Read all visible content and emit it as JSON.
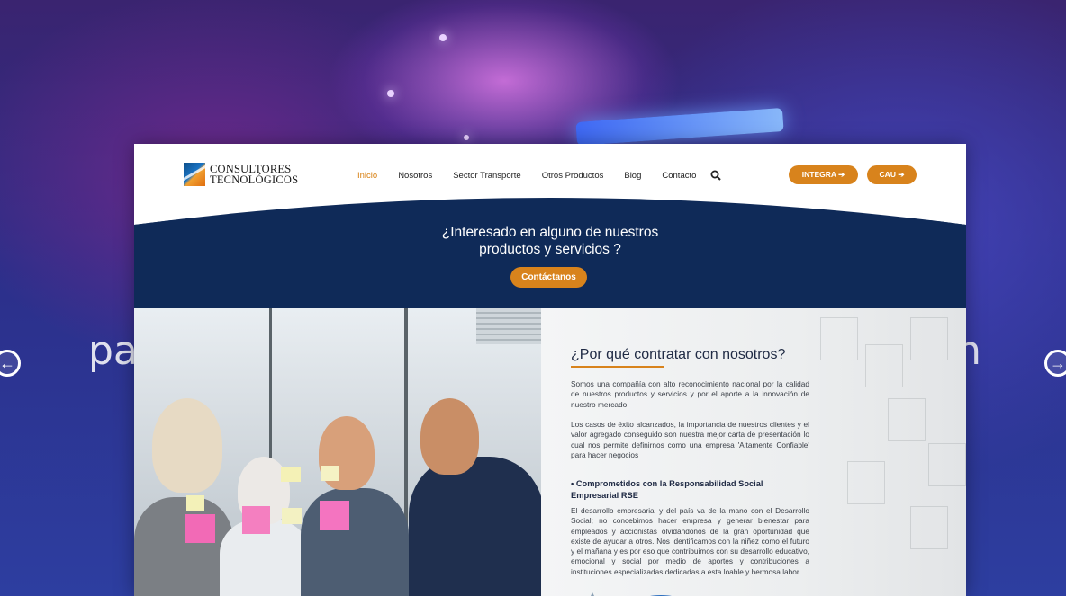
{
  "hero": {
    "bg_text_left": "pa",
    "bg_text_right": "n",
    "prev_arrow": "←",
    "next_arrow": "→"
  },
  "logo": {
    "line1": "CONSULTORES",
    "line2": "TECNOLÓGICOS"
  },
  "nav": {
    "items": [
      "Inicio",
      "Nosotros",
      "Sector Transporte",
      "Otros Productos",
      "Blog",
      "Contacto"
    ],
    "active_index": 0
  },
  "header_buttons": {
    "integra": "INTEGRA ➔",
    "cau": "CAU ➔"
  },
  "cta": {
    "title_line1": "¿Interesado en alguno de nuestros",
    "title_line2": "productos y servicios ?",
    "button": "Contáctanos"
  },
  "why": {
    "title": "¿Por qué contratar con nosotros?",
    "para1": "Somos una compañía con alto reconocimiento nacional por la calidad de nuestros productos y servicios y por el aporte a la innovación de nuestro mercado.",
    "para2": "Los casos de éxito alcanzados, la importancia de nuestros clientes y el valor agregado conseguido son nuestra mejor carta de presentación lo cual nos permite definirnos como una empresa 'Altamente Confiable' para hacer negocios",
    "subheading": "• Comprometidos con la Responsabilidad Social Empresarial RSE",
    "para3": "El desarrollo empresarial y del país va de la mano con el Desarrollo Social; no concebimos hacer empresa y generar bienestar para empleados y accionistas olvidándonos de la gran oportunidad que existe de ayudar a otros.  Nos identificamos con la niñez como el futuro y el mañana y es por eso que contribuimos con su desarrollo educativo, emocional y social por medio de aportes y contribuciones a instituciones especializadas dedicadas a esta loable y hermosa labor."
  },
  "colors": {
    "accent": "#d8831c",
    "navy": "#0f2a58",
    "nav_active": "#d88012"
  }
}
